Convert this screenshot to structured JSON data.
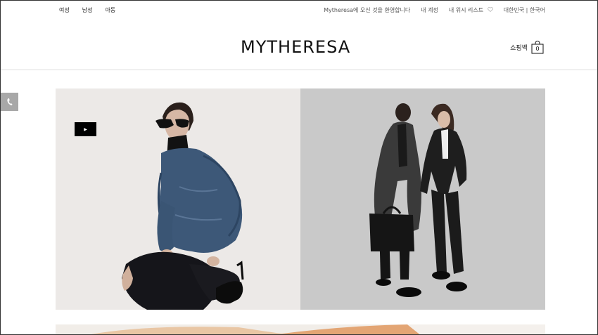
{
  "top_nav": {
    "items": [
      {
        "label": "여성"
      },
      {
        "label": "남성"
      },
      {
        "label": "아동"
      }
    ]
  },
  "utility": {
    "welcome": "Mytheresa에 오신 것을 환영합니다",
    "account": "내 계정",
    "wishlist": "내 위시 리스트",
    "region": "대한민국 | 한국어"
  },
  "header": {
    "logo": "MYTHERESA",
    "bag_label": "쇼핑백",
    "bag_count": "0"
  },
  "hero": {
    "left": {
      "alt": "Woman in denim jacket and sunglasses kneeling"
    },
    "right": {
      "alt": "Two men in dark tailored coats with leather bag"
    }
  },
  "icons": {
    "phone": "phone-icon",
    "heart": "heart-icon",
    "bag": "shopping-bag-icon",
    "play": "play-icon"
  }
}
